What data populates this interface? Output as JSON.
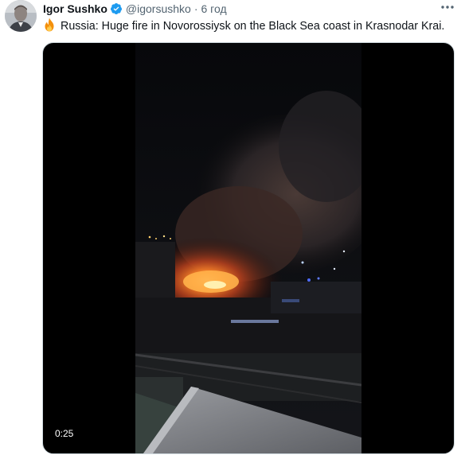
{
  "author": {
    "name": "Igor Sushko",
    "handle": "@igorsushko",
    "separator": "·",
    "time": "6 год",
    "verified": true
  },
  "tweet": {
    "emoji_icon": "fire-icon",
    "text": "Russia: Huge fire in Novorossiysk on the Black Sea coast in Krasnodar Krai."
  },
  "media": {
    "type": "video",
    "duration": "0:25"
  },
  "icons": {
    "verified": "verified-badge-icon",
    "more": "more-options-icon"
  },
  "colors": {
    "verified_blue": "#1d9bf0",
    "secondary_text": "#536471",
    "primary_text": "#0f1419"
  }
}
